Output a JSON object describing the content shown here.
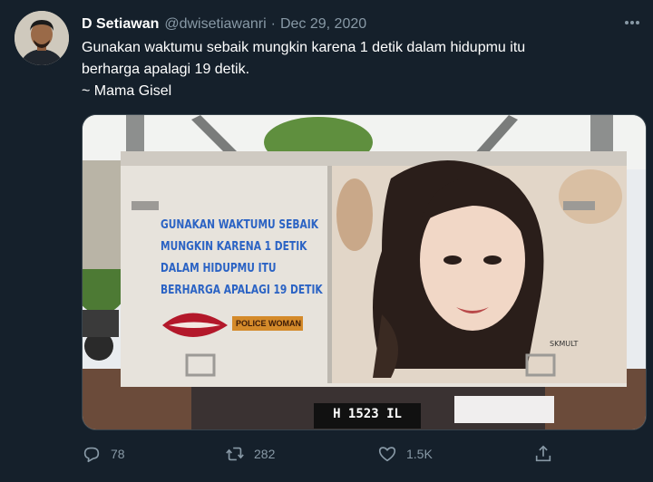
{
  "user": {
    "display_name": "D Setiawan",
    "handle": "@dwisetiawanri",
    "separator": "·",
    "date": "Dec 29, 2020"
  },
  "tweet": {
    "line1": "Gunakan waktumu sebaik mungkin karena 1 detik dalam hidupmu itu",
    "line2": "berharga apalagi 19 detik.",
    "line3": "~ Mama Gisel"
  },
  "media": {
    "painted_text": [
      "GUNAKAN WAKTUMU SEBAIK",
      "MUNGKIN KARENA 1 DETIK",
      "DALAM HIDUPMU ITU",
      "BERHARGA APALAGI 19 DETIK"
    ],
    "brand_text": "POLICE WOMAN",
    "plate": "H 1523 IL",
    "artist_tag": "SKMULT"
  },
  "actions": {
    "reply_count": "78",
    "retweet_count": "282",
    "like_count": "1.5K"
  },
  "icons": {
    "more": "more-icon",
    "reply": "reply-icon",
    "retweet": "retweet-icon",
    "like": "heart-icon",
    "share": "share-icon"
  },
  "colors": {
    "background": "#15202b",
    "secondary_text": "#8899a6",
    "painted_text": "#2b63c4"
  }
}
